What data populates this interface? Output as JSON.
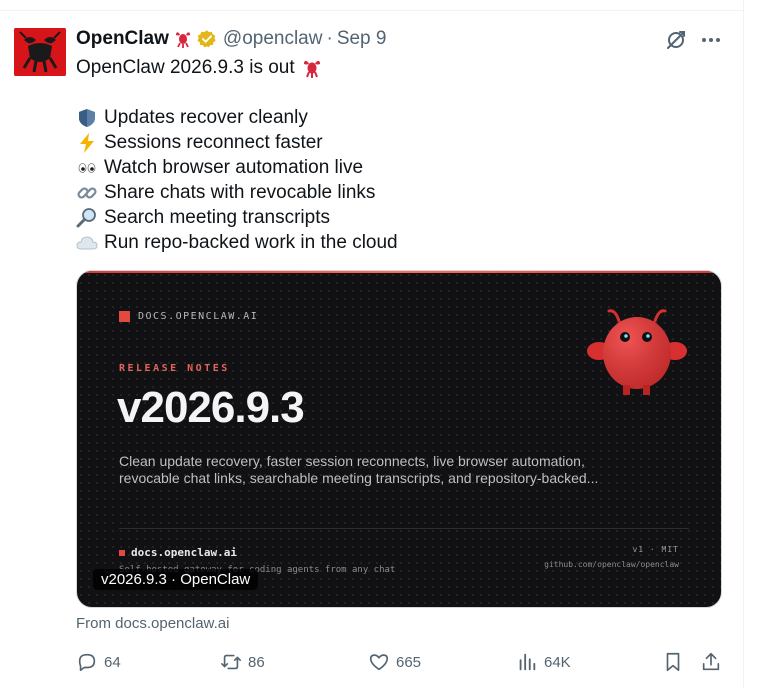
{
  "tweet": {
    "display_name": "OpenClaw",
    "handle": "@openclaw",
    "separator": "·",
    "date": "Sep 9",
    "headline": "OpenClaw 2026.9.3 is out",
    "lines": [
      {
        "icon": "shield-emoji",
        "text": "Updates recover cleanly"
      },
      {
        "icon": "lightning-emoji",
        "text": "Sessions reconnect faster"
      },
      {
        "icon": "eyes-emoji",
        "text": "Watch browser automation live"
      },
      {
        "icon": "link-emoji",
        "text": "Share chats with revocable links"
      },
      {
        "icon": "magnifier-emoji",
        "text": "Search meeting transcripts"
      },
      {
        "icon": "cloud-emoji",
        "text": "Run repo-backed work in the cloud"
      }
    ]
  },
  "card": {
    "docs_badge": "DOCS.OPENCLAW.AI",
    "eyebrow": "RELEASE NOTES",
    "version": "v2026.9.3",
    "description": "Clean update recovery, faster session reconnects, live browser automation, revocable chat links, searchable meeting transcripts, and repository-backed...",
    "footer_site": "docs.openclaw.ai",
    "footer_sub": "Self-hosted gateway for coding agents from any chat",
    "footer_meta": "v1 · MIT",
    "footer_repo": "github.com/openclaw/openclaw",
    "caption": "v2026.9.3 · OpenClaw",
    "from": "From docs.openclaw.ai"
  },
  "actions": {
    "replies": "64",
    "reposts": "86",
    "likes": "665",
    "views": "64K"
  },
  "colors": {
    "text": "#0f1419",
    "muted": "#536471",
    "verified": "#e2b719",
    "accent_red": "#e04a3f",
    "card_bg": "#111114"
  }
}
